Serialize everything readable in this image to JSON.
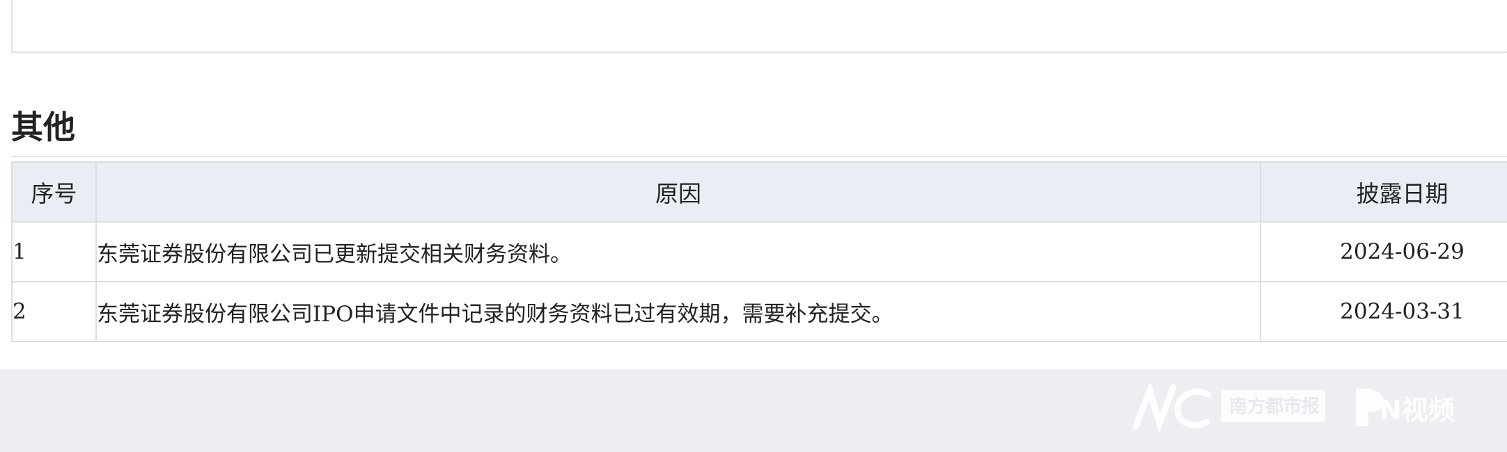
{
  "section": {
    "title": "其他"
  },
  "table": {
    "headers": {
      "index": "序号",
      "reason": "原因",
      "date": "披露日期"
    },
    "rows": [
      {
        "index": "1",
        "reason": "东莞证券股份有限公司已更新提交相关财务资料。",
        "date": "2024-06-29"
      },
      {
        "index": "2",
        "reason": "东莞证券股份有限公司IPO申请文件中记录的财务资料已过有效期，需要补充提交。",
        "date": "2024-03-31"
      }
    ]
  },
  "watermark": {
    "brand_mark": "NC",
    "newspaper": "南方都市报",
    "video": "N视频"
  },
  "colors": {
    "header_bg": "#e9eef5",
    "border": "#d9dde2",
    "footer_bg": "#eceef2"
  }
}
